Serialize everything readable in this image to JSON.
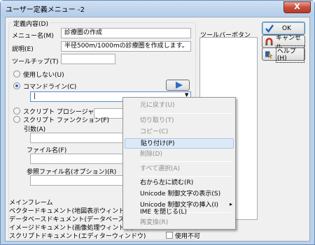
{
  "window": {
    "title": "ユーザー定義メニュー  -2",
    "close_glyph": "X"
  },
  "definition": {
    "group_label": "定義内容(D)",
    "menu_name_label": "メニュー名(M)",
    "menu_name_value": "診療圏の作成",
    "description_label": "説明(E)",
    "description_value": "半径500m/1000mの診療圏を作成します。",
    "tooltip_label": "ツールチップ(T)",
    "tooltip_value": ""
  },
  "options": {
    "unused_label": "使用しない(U)",
    "command_line_label": "コマンドライン(C)",
    "command_line_value": "|",
    "script_procedure_label": "スクリプト プロシージャ(V)",
    "script_function_label": "スクリプト ファンクション(F)",
    "args_label": "引数(A)",
    "filename_label": "ファイル名(F)",
    "reference_filename_label": "参照ファイル名(オプション)(R)"
  },
  "toolbar_button_label": "ツールバーボタン",
  "buttons": {
    "ok": "OK",
    "cancel": "キャンセル",
    "help": "ヘルプ(H)"
  },
  "main_frame": {
    "label": "メインフレーム",
    "items": [
      "ベクタードキュメント(地図表示ウィンドウ)",
      "データベースドキュメント(データベース表示ウィンドウ)",
      "イメージドキュメント(画像処理ウィンドウ)",
      "スクリプトドキュメント(エディターウィンドウ)"
    ]
  },
  "disable_label": "使用不可",
  "context_menu": {
    "items": [
      {
        "label": "元に戻す(U)",
        "disabled": true
      },
      {
        "label": "切り取り(T)",
        "disabled": true
      },
      {
        "label": "コピー(C)",
        "disabled": true
      },
      {
        "label": "貼り付け(P)",
        "disabled": false,
        "highlighted": true
      },
      {
        "label": "削除(D)",
        "disabled": true
      },
      {
        "label": "すべて選択(A)",
        "disabled": true
      },
      {
        "label": "右から左に読む(R)",
        "disabled": false
      },
      {
        "label": "Unicode 制御文字の表示(S)",
        "disabled": false
      },
      {
        "label": "Unicode 制御文字の挿入(I)",
        "disabled": false,
        "submenu": true
      },
      {
        "label": "IME を閉じる(L)",
        "disabled": false
      },
      {
        "label": "再変換(R)",
        "disabled": true
      }
    ],
    "submenu_arrow": "▸"
  },
  "colors": {
    "title_bar": "#b9d1ea",
    "close_button": "#c7503c",
    "menu_highlight": "#dce9f7",
    "play_arrow": "#2a6ec8"
  }
}
